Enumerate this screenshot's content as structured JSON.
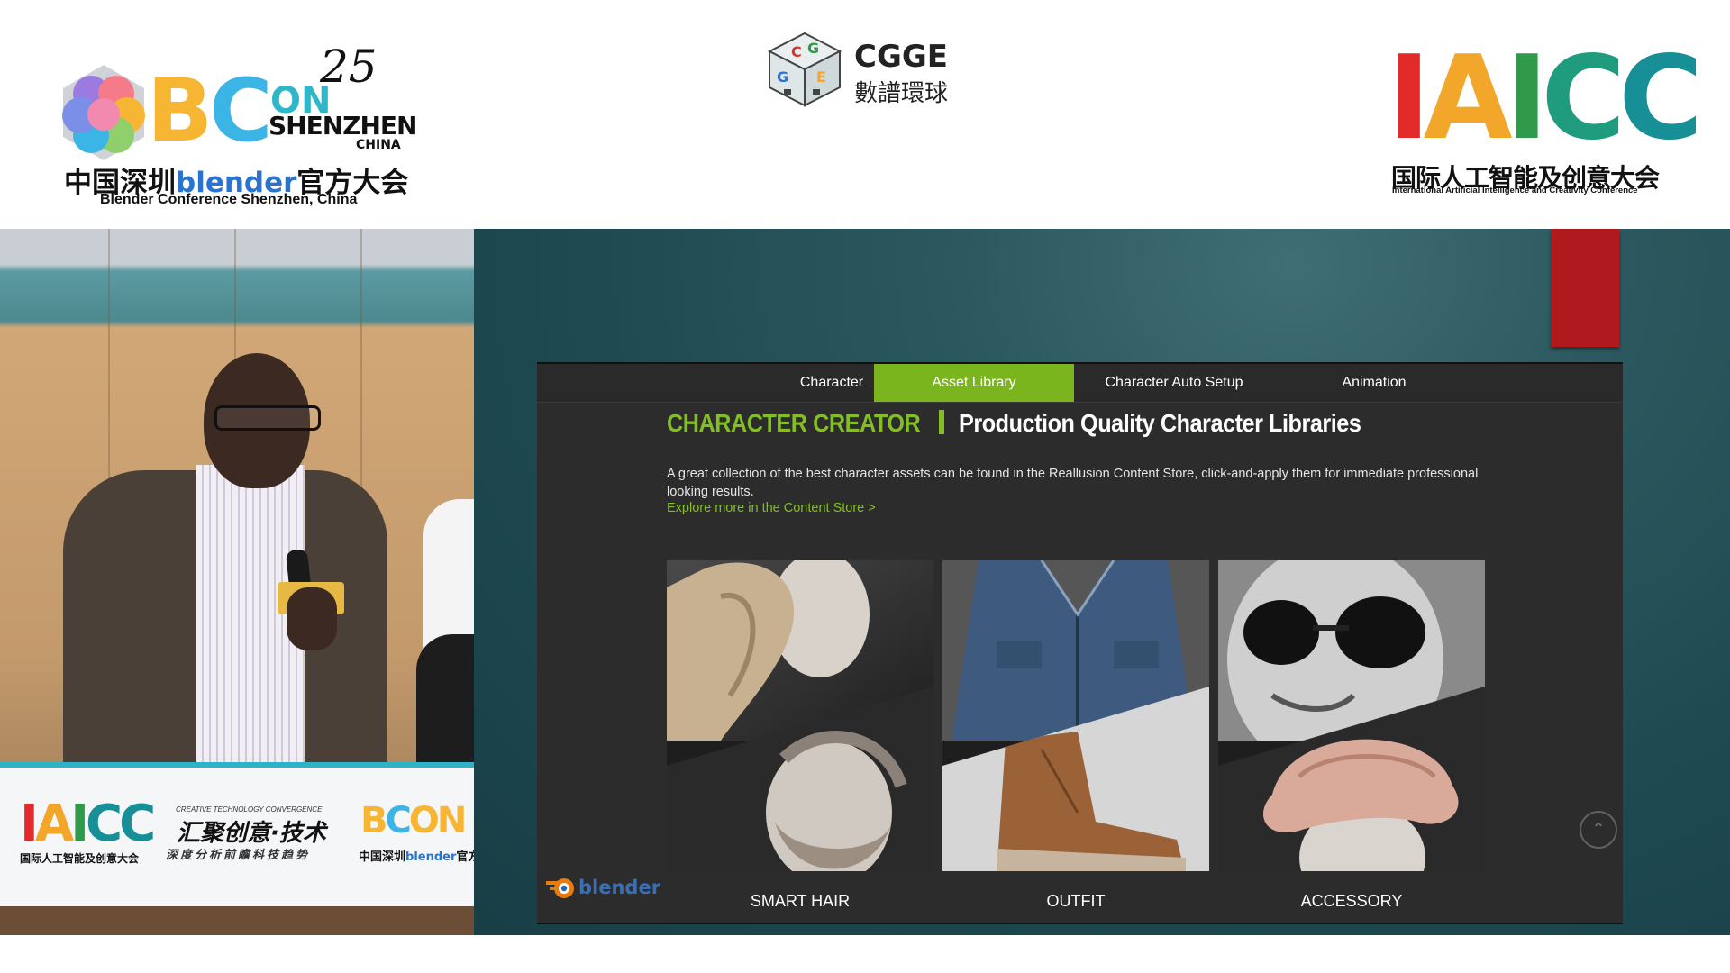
{
  "header": {
    "bcon": {
      "number": "25",
      "letters_b": "B",
      "letters_c": "C",
      "letters_on": "ON",
      "city": "SHENZHEN",
      "country": "CHINA",
      "cn_prefix": "中国深圳",
      "cn_blender": "blender",
      "cn_suffix": "官方大会",
      "en": "Blender Conference Shenzhen, China"
    },
    "cgge": {
      "title": "CGGE",
      "subtitle": "數譜環球"
    },
    "iaicc": {
      "letters": [
        "I",
        "A",
        "I",
        "C",
        "C"
      ],
      "cn": "国际人工智能及创意大会",
      "en": "International Artificial Intelligence and Creativity Conference"
    }
  },
  "speaker_video": {
    "podium": {
      "iaicc": "IAICC",
      "iaicc_cn": "国际人工智能及创意大会",
      "tagline_en": "CREATIVE TECHNOLOGY CONVERGENCE",
      "tagline_cn": "汇聚创意·技术",
      "tagline_cn2": "深度分析前瞻科技趋势",
      "bcon": "BCON",
      "bcon_cn_prefix": "中国深圳",
      "bcon_cn_blender": "blender",
      "bcon_cn_suffix": "官方"
    }
  },
  "slide": {
    "nav_tabs": [
      {
        "label": "Character",
        "active": false
      },
      {
        "label": "Asset Library",
        "active": true
      },
      {
        "label": "Character Auto Setup",
        "active": false
      },
      {
        "label": "Animation",
        "active": false
      }
    ],
    "heading_brand": "CHARACTER CREATOR",
    "heading_title": "Production Quality Character Libraries",
    "description": "A great collection of the best character assets can be found in the Reallusion Content Store, click-and-apply them for immediate professional looking results.",
    "explore_link": "Explore more in the Content Store >",
    "cards": [
      {
        "label": "SMART HAIR"
      },
      {
        "label": "OUTFIT"
      },
      {
        "label": "ACCESSORY"
      }
    ],
    "scroll_top_icon": "chevron-up",
    "footer_logo": "blender",
    "colors": {
      "accent_green": "#82be24",
      "active_tab": "#7ab51d",
      "red_tab": "#b0191e"
    }
  }
}
